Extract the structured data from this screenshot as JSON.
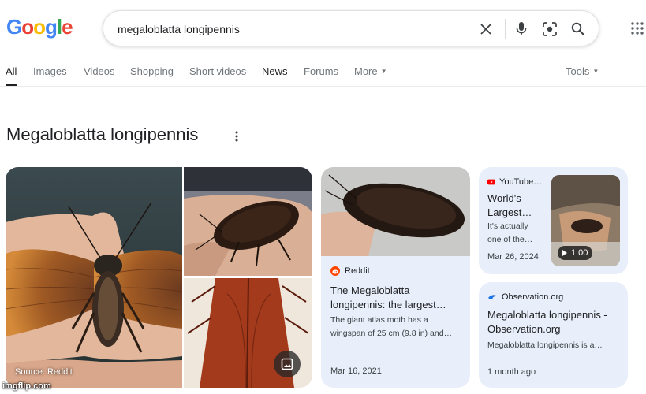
{
  "logo": {
    "letters": [
      "G",
      "o",
      "o",
      "g",
      "l",
      "e"
    ],
    "colors": [
      "#4285f4",
      "#ea4335",
      "#fbbc05",
      "#4285f4",
      "#34a853",
      "#ea4335"
    ]
  },
  "search": {
    "query": "megaloblatta longipennis"
  },
  "icons": {
    "clear": "close-icon",
    "voice": "microphone-icon",
    "lens": "camera-lens-icon",
    "search": "search-icon",
    "apps": "apps-grid-icon"
  },
  "tabs": [
    "All",
    "Images",
    "Videos",
    "Shopping",
    "Short videos",
    "News",
    "Forums",
    "More",
    "Tools"
  ],
  "title": "Megaloblatta longipennis",
  "images": {
    "main_source": "Source: Reddit"
  },
  "reddit_card": {
    "source": "Reddit",
    "title": "The Megaloblatta longipennis: the largest…",
    "snippet": "The giant atlas moth has a wingspan of 25 cm (9.8 in) and…",
    "date": "Mar 16, 2021"
  },
  "youtube_card": {
    "source": "YouTube…",
    "title": "World's Largest…",
    "snippet": "It's actually one of the…",
    "date": "Mar 26, 2024",
    "duration": "1:00"
  },
  "observation_card": {
    "source": "Observation.org",
    "title": "Megaloblatta longipennis - Observation.org",
    "snippet": "Megaloblatta longipennis is a…",
    "date": "1 month ago"
  },
  "watermark": "imgflip.com",
  "colors": {
    "card_bg": "#e8effa",
    "reddit": "#ff4500",
    "youtube": "#ff0000",
    "observation": "#1a73e8"
  }
}
